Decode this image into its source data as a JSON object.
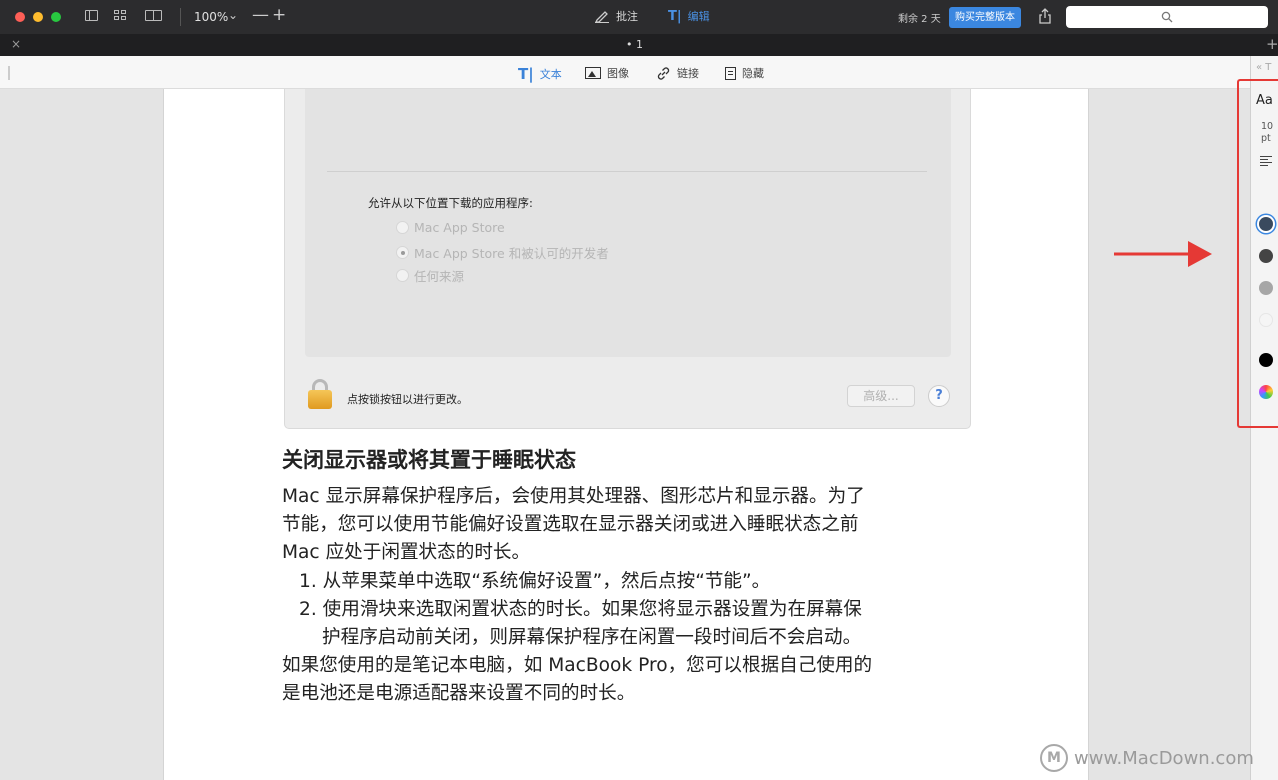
{
  "toolbar": {
    "zoom": "100%",
    "zoom_chevron": "⌄",
    "zoom_out": "—",
    "zoom_in": "+",
    "annotate_label": "批注",
    "edit_label": "编辑",
    "trial_text": "剩余 2 天",
    "buy_label": "购买完整版本",
    "search_placeholder": ""
  },
  "tabs": {
    "close": "×",
    "title": "• 1",
    "add": "+"
  },
  "edit_tools": [
    {
      "label": "文本",
      "glyph": "T|"
    },
    {
      "label": "图像"
    },
    {
      "label": "链接",
      "glyph": "🔗"
    },
    {
      "label": "隐藏"
    }
  ],
  "prefs_panel": {
    "heading": "允许从以下位置下载的应用程序:",
    "options": [
      {
        "label": "Mac App Store",
        "selected": false
      },
      {
        "label": "Mac App Store 和被认可的开发者",
        "selected": true
      },
      {
        "label": "任何来源",
        "selected": false
      }
    ],
    "lock_text": "点按锁按钮以进行更改。",
    "advanced_label": "高级...",
    "help_label": "?"
  },
  "document": {
    "heading": "关闭显示器或将其置于睡眠状态",
    "lines": [
      "Mac 显示屏幕保护程序后，会使用其处理器、图形芯片和显示器。为了",
      "节能，您可以使用节能偏好设置选取在显示器关闭或进入睡眠状态之前",
      "Mac 应处于闲置状态的时长。",
      "1. 从苹果菜单中选取“系统偏好设置”，然后点按“节能”。",
      "2. 使用滑块来选取闲置状态的时长。如果您将显示器设置为在屏幕保",
      "护程序启动前关闭，则屏幕保护程序在闲置一段时间后不会启动。",
      "如果您使用的是笔记本电脑，如 MacBook Pro，您可以根据自己使用的",
      "是电池还是电源适配器来设置不同的时长。"
    ]
  },
  "sidebar": {
    "collapse": "« T",
    "font_label": "Aa",
    "font_size": "10 pt",
    "swatches": [
      "#3a4a5e",
      "#444444",
      "#a6a6a6",
      "#f5f5f5",
      "#000000",
      "multicolor"
    ]
  },
  "watermark": {
    "logo": "M",
    "text": "www.MacDown.com"
  },
  "colors": {
    "accent": "#3b87e0",
    "highlight": "#e53935"
  }
}
